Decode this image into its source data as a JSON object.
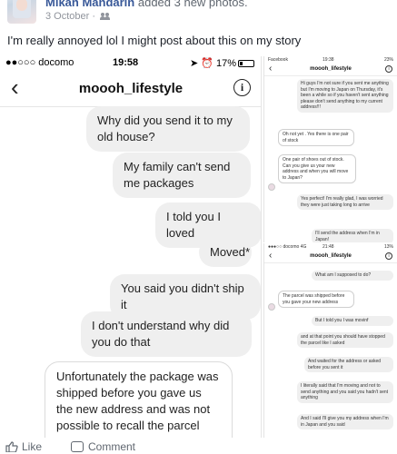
{
  "post": {
    "author": "Mikan Mandarin",
    "action": " added 3 new photos.",
    "date": "3 October",
    "text": "I'm really annoyed lol I might post about this on my story"
  },
  "main_shot": {
    "status": {
      "carrier": "●●○○○ docomo",
      "time": "19:58",
      "battery": "17%"
    },
    "title": "moooh_lifestyle",
    "messages": [
      {
        "from": "me",
        "text": "Why did you send it to my old house?"
      },
      {
        "from": "me",
        "text": "My family can't send me packages"
      },
      {
        "from": "me",
        "text": "I told you I loved"
      },
      {
        "from": "me",
        "text": "Moved*"
      },
      {
        "from": "me",
        "text": "You said you didn't ship it"
      },
      {
        "from": "me",
        "text": "I don't understand why did you do that"
      },
      {
        "from": "them",
        "text": "Unfortunately the package was shipped before you gave us the new address and was not possible to recall the parcel anymore"
      }
    ]
  },
  "side_shot_1": {
    "status": {
      "left": "Facebook",
      "time": "19:38",
      "battery": "23%"
    },
    "title": "moooh_lifestyle",
    "messages": [
      {
        "from": "me",
        "text": "Hi guys I'm not sure if you sent me anything but I'm moving to Japan on Thursday, it's been a while so if you haven't sent anything please don't send anything to my current address!!!"
      },
      {
        "from": "them",
        "text": "Oh not yet . Yes there is one pair of stock"
      },
      {
        "from": "them",
        "text": "One pair of shoes out of stock. Can you give us your new address and when you will move to Japan?"
      },
      {
        "from": "me",
        "text": "Yes perfect! I'm really glad, I was worried they were just taking long to arrive"
      },
      {
        "from": "me",
        "text": "I'll send the address when I'm in Japan!"
      }
    ]
  },
  "side_shot_2": {
    "status": {
      "left": "●●●○○ docomo 4G",
      "time": "21:48",
      "battery": "13%"
    },
    "title": "moooh_lifestyle",
    "messages": [
      {
        "from": "me",
        "text": "What am I supposed to do?"
      },
      {
        "from": "them",
        "text": "The parcel was shipped before you gave your new address"
      },
      {
        "from": "me",
        "text": "But I told you I was movinf"
      },
      {
        "from": "me",
        "text": "and at that point you should have stopped the parcel like I asked"
      },
      {
        "from": "me",
        "text": "And waited for the address or asked before you sent it"
      },
      {
        "from": "me",
        "text": "I literally said that I'm moving and not to send anything and you said you hadn't sent anything"
      },
      {
        "from": "me",
        "text": "And I said I'll give you my address when I'm in Japan and you said"
      }
    ]
  },
  "actions": {
    "like": "Like",
    "comment": "Comment"
  },
  "colors": {
    "link": "#385898",
    "meta": "#90949c",
    "bubble": "#efefef"
  }
}
